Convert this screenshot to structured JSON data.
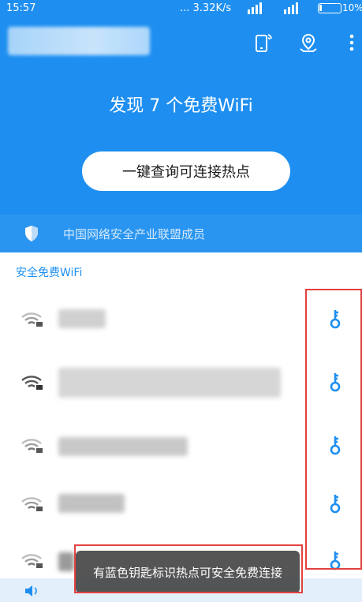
{
  "status_bar": {
    "time": "15:57",
    "network": "... 3.32K/s",
    "battery_pct": "10%"
  },
  "header": {
    "found_title": "发现 7 个免费WiFi",
    "query_button": "一键查询可连接热点",
    "icons": [
      "phone-signal-icon",
      "map-pin-icon",
      "more-vertical-icon"
    ]
  },
  "alliance": {
    "label": "中国网络安全产业联盟成员",
    "icon": "shield-icon"
  },
  "section": {
    "title": "安全免费WiFi"
  },
  "wifi_list": [
    {
      "icon": "wifi-lock-icon",
      "key_icon": "key-icon"
    },
    {
      "icon": "wifi-lock-icon",
      "key_icon": "key-icon"
    },
    {
      "icon": "wifi-lock-icon",
      "key_icon": "key-icon"
    },
    {
      "icon": "wifi-lock-icon",
      "key_icon": "key-icon"
    },
    {
      "icon": "wifi-lock-icon",
      "key_icon": "key-icon"
    }
  ],
  "toast": {
    "message": "有蓝色钥匙标识热点可安全免费连接"
  },
  "colors": {
    "primary_blue": "#1e8ff0",
    "annotation_red": "#e34141"
  }
}
